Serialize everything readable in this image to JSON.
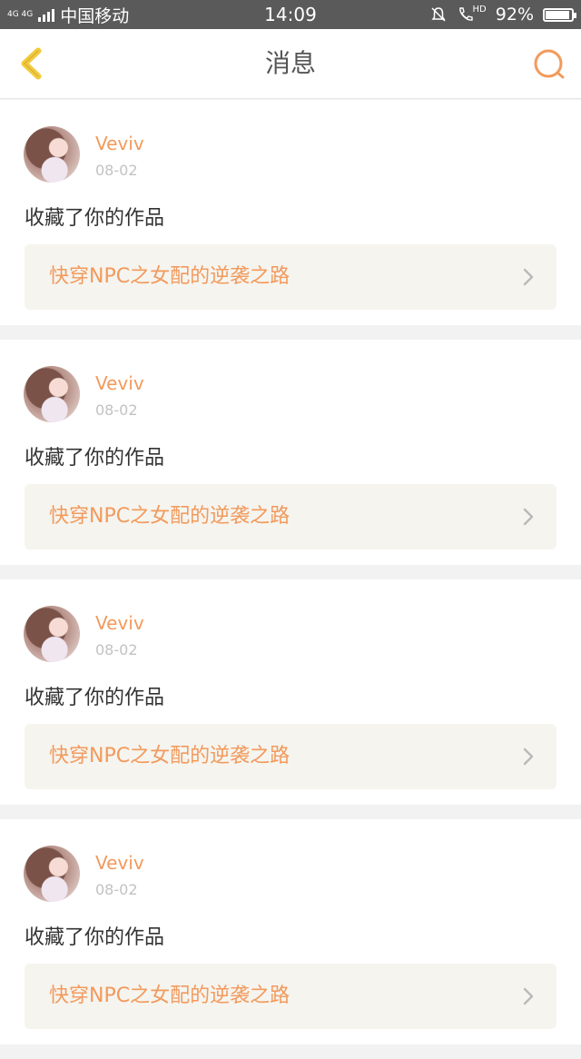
{
  "status_bar": {
    "network": "4G 4G",
    "carrier": "中国移动",
    "time": "14:09",
    "hd": "HD",
    "battery_percent_text": "92%",
    "battery_level": 0.92
  },
  "nav": {
    "title": "消息",
    "back_icon": "chevron-left-icon",
    "search_icon": "search-icon",
    "accent_color": "#f29a5c"
  },
  "messages": [
    {
      "username": "Veviv",
      "date": "08-02",
      "action": "收藏了你的作品",
      "work_title": "快穿NPC之女配的逆袭之路"
    },
    {
      "username": "Veviv",
      "date": "08-02",
      "action": "收藏了你的作品",
      "work_title": "快穿NPC之女配的逆袭之路"
    },
    {
      "username": "Veviv",
      "date": "08-02",
      "action": "收藏了你的作品",
      "work_title": "快穿NPC之女配的逆袭之路"
    },
    {
      "username": "Veviv",
      "date": "08-02",
      "action": "收藏了你的作品",
      "work_title": "快穿NPC之女配的逆袭之路"
    }
  ]
}
